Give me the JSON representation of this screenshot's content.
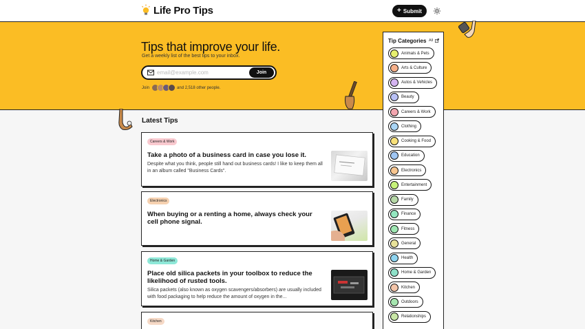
{
  "header": {
    "app_name": "Life Pro Tips",
    "submit_label": "Submit"
  },
  "hero": {
    "title": "Tips that improve your life.",
    "subtitle": "Get a weekly list of the best tips to your inbox.",
    "email_placeholder": "email@example.com",
    "join_button": "Join",
    "join_prefix": "Join",
    "join_suffix": "and 2,518 other people."
  },
  "latest": {
    "title": "Latest Tips",
    "cards": [
      {
        "category": "Careers & Work",
        "badge_color": "#f9c9cf",
        "title": "Take a photo of a business card in case you lose it.",
        "description": "Despite what you think, people still hand out business cards! I like to keep them all in an album called \"Business Cards\"."
      },
      {
        "category": "Electronics",
        "badge_color": "#f6d1b0",
        "title": "When buying or a renting a home, always check your cell phone signal.",
        "description": ""
      },
      {
        "category": "Home & Garden",
        "badge_color": "#8ee8d8",
        "title": "Place old silica packets in your toolbox to reduce the likelihood of rusted tools.",
        "description": "Silica packets (also known as oxygen scavengers/absorbers) are usually included with food packaging to help reduce the amount of oxygen in the..."
      },
      {
        "category": "Kitchen",
        "badge_color": "#f6d9c6",
        "title": "",
        "description": ""
      }
    ]
  },
  "sidebar": {
    "title": "Tip Categories",
    "all_label": "All",
    "categories": [
      {
        "label": "Animals & Pets",
        "color": "#e6ef6f"
      },
      {
        "label": "Arts & Culture",
        "color": "#f6b08a"
      },
      {
        "label": "Autos & Vehicles",
        "color": "#d4b4f0"
      },
      {
        "label": "Beauty",
        "color": "#b8c0f5"
      },
      {
        "label": "Careers & Work",
        "color": "#f3a6b0"
      },
      {
        "label": "Clothing",
        "color": "#a9d5f5"
      },
      {
        "label": "Cooking & Food",
        "color": "#f7e07a"
      },
      {
        "label": "Education",
        "color": "#9fc6f3"
      },
      {
        "label": "Electronics",
        "color": "#f8c690"
      },
      {
        "label": "Entertainment",
        "color": "#c6f27a"
      },
      {
        "label": "Family",
        "color": "#b7d9a8"
      },
      {
        "label": "Finance",
        "color": "#94e6c0"
      },
      {
        "label": "Fitness",
        "color": "#9ee6b2"
      },
      {
        "label": "General",
        "color": "#e8e29a"
      },
      {
        "label": "Health",
        "color": "#8ed4f0"
      },
      {
        "label": "Home & Garden",
        "color": "#8ee0c8"
      },
      {
        "label": "Kitchen",
        "color": "#f3c4a8"
      },
      {
        "label": "Outdoors",
        "color": "#a6e6b0"
      },
      {
        "label": "Relationships",
        "color": "#c8e6a6"
      }
    ]
  }
}
